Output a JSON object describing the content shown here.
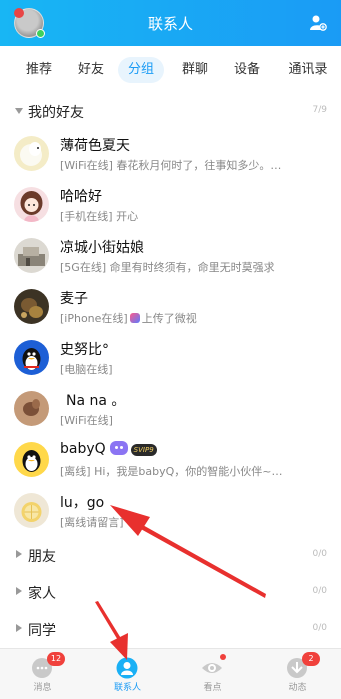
{
  "header": {
    "title": "联系人",
    "brand_color": "#1a9bf5"
  },
  "tabs": [
    {
      "label": "推荐"
    },
    {
      "label": "好友"
    },
    {
      "label": "分组",
      "active": true
    },
    {
      "label": "群聊"
    },
    {
      "label": "设备"
    },
    {
      "label": "通讯录"
    }
  ],
  "groups": {
    "friends": {
      "name": "我的好友",
      "count": "7/9"
    },
    "pengyou": {
      "name": "朋友",
      "count": "0/0"
    },
    "family": {
      "name": "家人",
      "count": "0/0"
    },
    "classmates": {
      "name": "同学",
      "count": "0/0"
    }
  },
  "contacts": [
    {
      "name": "薄荷色夏天",
      "status": "[WiFi在线] 春花秋月何时了，往事知多少。…"
    },
    {
      "name": "哈哈好",
      "status": "[手机在线] 开心"
    },
    {
      "name": "凉城小街姑娘",
      "status": "[5G在线] 命里有时终须有，命里无时莫强求"
    },
    {
      "name": "麦子",
      "status_prefix": "[iPhone在线]",
      "status": "上传了微视"
    },
    {
      "name": "史努比°",
      "status": "[电脑在线]"
    },
    {
      "name": "Na na 。",
      "status": "[WiFi在线]"
    },
    {
      "name": "babyQ",
      "vip": "SVIP9",
      "status": "[离线] Hi，我是babyQ，你的智能小伙伴~…"
    },
    {
      "name": "lu，go",
      "status": "[离线请留言]"
    }
  ],
  "bottom_nav": [
    {
      "label": "消息",
      "badge": "12"
    },
    {
      "label": "联系人",
      "active": true
    },
    {
      "label": "看点",
      "dot": true
    },
    {
      "label": "动态",
      "badge": "2"
    }
  ],
  "icons": [
    "avatar-me",
    "add-friend-icon",
    "message-icon",
    "contacts-icon",
    "kandian-eye-icon",
    "dynamic-icon"
  ],
  "colors": {
    "accent": "#1a9bf5",
    "arrow": "#e8302e",
    "badge": "#f0413c"
  }
}
